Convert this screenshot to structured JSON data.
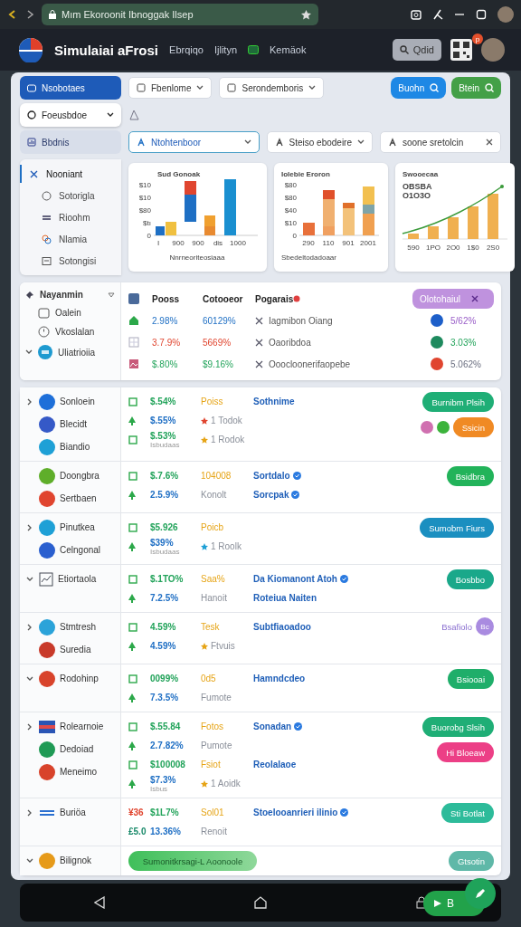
{
  "browser": {
    "url": "Mım Ekoroonit Ibnoggak Ilsep"
  },
  "header": {
    "title": "Simulaiai aFrosi",
    "nav": [
      "Ebrqiqo",
      "Ijlityn",
      "Kemäok"
    ],
    "search": "Qdid",
    "badge": "p"
  },
  "toolbar": {
    "side": [
      {
        "label": "Nsobotaes",
        "kind": "tab",
        "selected": true
      },
      {
        "label": "Foeusbdoe",
        "kind": "dropdown",
        "selected": false
      },
      {
        "label": "Bbdnis",
        "kind": "tab",
        "selected": false
      }
    ],
    "dropdowns": [
      "Fbenlome",
      "Serondemboris"
    ],
    "buttons": [
      {
        "label": "Buohn",
        "color": "#1e88e5"
      },
      {
        "label": "Btein",
        "color": "#43a047"
      }
    ],
    "filters": [
      {
        "label": "Ntohtenboor",
        "selected": true
      },
      {
        "label": "Steiso ebodeire",
        "selected": false
      },
      {
        "label": "soone sretolcin",
        "selected": false
      }
    ]
  },
  "menu": [
    {
      "label": "Nooniant",
      "selected": true
    },
    {
      "label": "Sotorigla",
      "selected": false
    },
    {
      "label": "Rioohm",
      "selected": false
    },
    {
      "label": "Nlamia",
      "selected": false
    },
    {
      "label": "Sotongisi",
      "selected": false
    }
  ],
  "charts": [
    {
      "kind": "grouped",
      "title": "Sud Gonoak",
      "yticks": [
        "$10",
        "$10",
        "$80",
        "$tı",
        "0"
      ],
      "xticks": [
        "I",
        "900",
        "900",
        "dis",
        "1000"
      ],
      "xlabel": "Nnrneoriteosiaaa"
    },
    {
      "kind": "stacked",
      "title": "Iolebie Eroron",
      "yticks": [
        "$80",
        "$80",
        "$40",
        "$10",
        "0"
      ],
      "xticks": [
        "290",
        "110",
        "901",
        "2001"
      ],
      "xlabel": "Sbedeltodadoaar"
    },
    {
      "kind": "trend",
      "title": "Swooecaa",
      "highlight": [
        "OBSBA",
        "O1O3O"
      ],
      "xticks": [
        "590",
        "1PO",
        "2O0",
        "1$0",
        "2S0"
      ]
    }
  ],
  "summary": {
    "filter": "Nayanmin",
    "items": [
      "Oalein",
      "Vkoslalan",
      "Uliatrioiia"
    ],
    "columns": [
      "Pooss",
      "Cotooeor",
      "Pogarais"
    ],
    "chip": "Olotohaiul",
    "rows": [
      {
        "a": "2.98%",
        "b": "60129%",
        "name": "Iagmibon Oiang",
        "color": "#1d5fc9",
        "share": "5/62%"
      },
      {
        "a": "3.7.9%",
        "b": "5669%",
        "name": "Oaoribdoa",
        "color": "#1e8a5e",
        "share": "3.03%"
      },
      {
        "a": "$.80%",
        "b": "$9.16%",
        "name": "Ooocloonerifaopebe",
        "color": "#e0452f",
        "share": "5.062%"
      }
    ]
  },
  "groups": [
    {
      "expanded": false,
      "items": [
        {
          "name": "Sonloein",
          "color": "#1e6fd9"
        },
        {
          "name": "Blecidt",
          "color": "#3559c7"
        },
        {
          "name": "Biandio",
          "color": "#1ea0d6"
        }
      ],
      "lines": [
        {
          "value": "$.54%",
          "mid": "Poiss",
          "link": "Sothnime",
          "verified": false
        },
        {
          "value": "$.55%",
          "mid": "1 Todok",
          "color": "#e0452f"
        },
        {
          "value": "$.53%",
          "sub": "Isbudaas",
          "mid": "1 Rodok",
          "color": "#e6a416"
        }
      ],
      "actions": [
        {
          "kind": "button",
          "label": "Burnibm Plsih",
          "color": "#1fae76"
        },
        {
          "kind": "toggles",
          "label": "Ssicin",
          "color": "#f08a24"
        }
      ]
    },
    {
      "items": [
        {
          "name": "Doongbra",
          "color": "#5fae2a"
        },
        {
          "name": "Sertbaen",
          "color": "#e0452f"
        }
      ],
      "lines": [
        {
          "value": "$.7.6%",
          "mid": "104008",
          "link": "Sortdalo",
          "verified": true
        },
        {
          "value": "2.5.9%",
          "mid": "Konolt",
          "link": "Sorcpak",
          "verified": true
        }
      ],
      "actions": [
        {
          "kind": "button",
          "label": "Bsidbra",
          "color": "#22b35a"
        }
      ]
    },
    {
      "expanded": false,
      "items": [
        {
          "name": "Pinutkea",
          "color": "#1ea0d6"
        },
        {
          "name": "Celngonal",
          "color": "#2a5fcf"
        }
      ],
      "lines": [
        {
          "value": "$5.926",
          "mid": "Poicb"
        },
        {
          "value": "$39%",
          "sub": "Isbudaas",
          "mid": "1 Roolk",
          "color": "#1ea0d6"
        }
      ],
      "actions": [
        {
          "kind": "button",
          "label": "Sumobm Fiurs",
          "color": "#1b8fc0"
        }
      ]
    },
    {
      "expanded": true,
      "items": [
        {
          "name": "Etiortaola",
          "kind": "chart"
        }
      ],
      "lines": [
        {
          "value": "$.1TO%",
          "mid": "Saa%",
          "link": "Da Kiomanont Atoh",
          "verified": true
        },
        {
          "value": "7.2.5%",
          "mid": "Hanoit",
          "link": "Roteiua Naiten",
          "verified": false
        }
      ],
      "actions": [
        {
          "kind": "button",
          "label": "Bosbbo",
          "color": "#1aa88a"
        }
      ]
    },
    {
      "expanded": false,
      "items": [
        {
          "name": "Stmtresh",
          "color": "#2ba3d9"
        },
        {
          "name": "Suredia",
          "color": "#c83a2a"
        }
      ],
      "lines": [
        {
          "value": "4.59%",
          "mid": "Tesk",
          "link": "Subtfiaoadoo",
          "verified": false
        },
        {
          "value": "4.59%",
          "mid": "Ftvuis",
          "color": "#e6a416"
        }
      ],
      "actions": [
        {
          "kind": "avatar",
          "label": "Bsafiolo",
          "avatar": "Bc",
          "color": "#a98be0"
        }
      ]
    },
    {
      "expanded": true,
      "items": [
        {
          "name": "Rodohinp",
          "color": "#d8432b"
        }
      ],
      "lines": [
        {
          "value": "0099%",
          "mid": "0d5",
          "link": "Hamndcdeo",
          "verified": false
        },
        {
          "value": "7.3.5%",
          "mid": "Fumote"
        }
      ],
      "actions": [
        {
          "kind": "button",
          "label": "Bsiooai",
          "color": "#1fae6a"
        }
      ]
    },
    {
      "expanded": false,
      "items": [
        {
          "name": "Rolearnoie",
          "color": "#2a55b5",
          "kind": "flag"
        },
        {
          "name": "Dedoiad",
          "color": "#1f9a55"
        },
        {
          "name": "Meneimo",
          "color": "#d8432b"
        }
      ],
      "lines": [
        {
          "value": "$.55.84",
          "mid": "Fotos",
          "link": "Sonadan",
          "verified": true
        },
        {
          "value": "2.7.82%",
          "mid": "Pumote"
        },
        {
          "value": "$100008",
          "mid": "Fsiot",
          "link": "Reolalaoe",
          "verified": false
        },
        {
          "value": "$7.3%",
          "sub": "Isbus",
          "mid": "1 Aoidk",
          "color": "#e6a416"
        }
      ],
      "actions": [
        {
          "kind": "button",
          "label": "Buorobg Slsih",
          "color": "#1fae76"
        },
        {
          "kind": "button",
          "label": "Hi Bloeaw",
          "color": "#ec3f86"
        }
      ]
    },
    {
      "expanded": false,
      "items": [
        {
          "name": "Buriöa",
          "kind": "bars"
        }
      ],
      "lines": [
        {
          "tag": "¥36",
          "value": "$1L7%",
          "mid": "Sol01",
          "link": "Stoelooanrieri ilinio",
          "verified": true
        },
        {
          "tag": "£5.0",
          "value": "13.36%",
          "mid": "Renoit"
        }
      ],
      "actions": [
        {
          "kind": "button",
          "label": "Sti Botlat",
          "color": "#2dbb9a"
        }
      ]
    },
    {
      "expanded": true,
      "items": [
        {
          "name": "Bilignok",
          "color": "#e69a1a"
        }
      ],
      "banner": "Sumonitkrsagi-L Aoonoole",
      "actions": [
        {
          "kind": "button",
          "label": "Gtsotin",
          "color": "#5fb8a8"
        }
      ]
    }
  ],
  "fab": "B"
}
